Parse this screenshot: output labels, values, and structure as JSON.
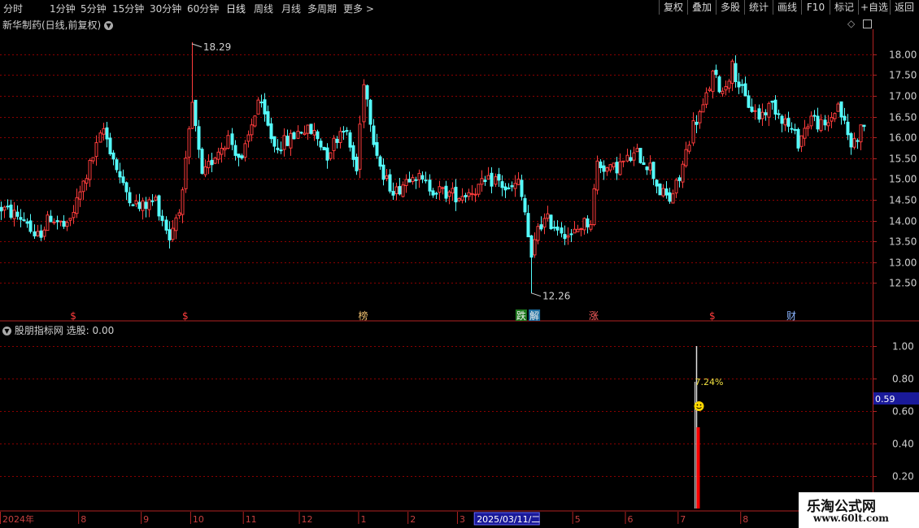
{
  "toolbar": {
    "periods": [
      "分时",
      "1分钟",
      "5分钟",
      "15分钟",
      "30分钟",
      "60分钟",
      "日线",
      "周线",
      "月线",
      "多周期",
      "更多 >"
    ],
    "buttons": [
      "复权",
      "叠加",
      "多股",
      "统计",
      "画线",
      "F10",
      "标记",
      "+自选",
      "返回"
    ]
  },
  "main_panel": {
    "title": "新华制药(日线,前复权)"
  },
  "sub_panel": {
    "title": "股朋指标网",
    "value_label": "选股:",
    "value": "0.00"
  },
  "watermark": {
    "line1": "乐淘公式网",
    "line2": "www.60lt.com"
  },
  "colors": {
    "up": "#ff3c3c",
    "down": "#54fcfc",
    "grid": "#8b0000",
    "axis": "#b22222",
    "highlight": "#1a1a9a"
  },
  "chart_data": [
    {
      "type": "candlestick",
      "title": "新华制药(日线,前复权)",
      "ylim": [
        12.0,
        18.6
      ],
      "y_ticks": [
        "18.00",
        "17.50",
        "17.00",
        "16.50",
        "16.00",
        "15.50",
        "15.00",
        "14.50",
        "14.00",
        "13.50",
        "13.00",
        "12.50"
      ],
      "annotations": [
        {
          "text": "18.29",
          "kind": "high",
          "date_index": 58
        },
        {
          "text": "12.26",
          "kind": "low",
          "date_index": 161
        }
      ],
      "markers": [
        {
          "text": "$",
          "date_index": 22,
          "color": "#ff3c3c"
        },
        {
          "text": "$",
          "date_index": 56,
          "color": "#ff3c3c"
        },
        {
          "text": "榜",
          "date_index": 110,
          "color": "#f0c070"
        },
        {
          "text": "跌",
          "date_index": 158,
          "color": "#f0f0f0",
          "bg": "#1e7a1e"
        },
        {
          "text": "解",
          "date_index": 162,
          "color": "#f0f0f0",
          "bg": "#1e6ea0"
        },
        {
          "text": "涨",
          "date_index": 180,
          "color": "#ff6060"
        },
        {
          "text": "$",
          "date_index": 216,
          "color": "#ff3c3c"
        },
        {
          "text": "财",
          "date_index": 240,
          "color": "#8ab4ff"
        }
      ],
      "x_labels": [
        {
          "text": "2024年",
          "date_index": 0
        },
        {
          "text": "8",
          "date_index": 24
        },
        {
          "text": "9",
          "date_index": 43
        },
        {
          "text": "10",
          "date_index": 58
        },
        {
          "text": "11",
          "date_index": 74
        },
        {
          "text": "12",
          "date_index": 91
        },
        {
          "text": "1",
          "date_index": 109
        },
        {
          "text": "2",
          "date_index": 124
        },
        {
          "text": "3",
          "date_index": 139
        },
        {
          "text": "2025/03/11/二",
          "date_index": 144,
          "highlight": true
        },
        {
          "text": "5",
          "date_index": 174
        },
        {
          "text": "6",
          "date_index": 190
        },
        {
          "text": "7",
          "date_index": 206
        },
        {
          "text": "8",
          "date_index": 225
        },
        {
          "text": "9",
          "date_index": 243
        }
      ],
      "anchors": [
        [
          0,
          14.3
        ],
        [
          8,
          14.0
        ],
        [
          10,
          13.5
        ],
        [
          15,
          14.1
        ],
        [
          20,
          13.8
        ],
        [
          26,
          15.1
        ],
        [
          31,
          16.2
        ],
        [
          34,
          15.5
        ],
        [
          37,
          14.8
        ],
        [
          42,
          14.3
        ],
        [
          47,
          14.5
        ],
        [
          51,
          13.6
        ],
        [
          55,
          14.6
        ],
        [
          58,
          16.8
        ],
        [
          61,
          15.0
        ],
        [
          65,
          15.6
        ],
        [
          69,
          16.0
        ],
        [
          73,
          15.4
        ],
        [
          78,
          16.9
        ],
        [
          83,
          15.8
        ],
        [
          87,
          15.9
        ],
        [
          91,
          16.2
        ],
        [
          95,
          16.1
        ],
        [
          99,
          15.6
        ],
        [
          104,
          16.3
        ],
        [
          108,
          15.2
        ],
        [
          110,
          17.4
        ],
        [
          113,
          16.0
        ],
        [
          116,
          15.0
        ],
        [
          120,
          14.7
        ],
        [
          125,
          15.2
        ],
        [
          128,
          14.9
        ],
        [
          133,
          14.7
        ],
        [
          139,
          14.6
        ],
        [
          145,
          14.8
        ],
        [
          150,
          15.0
        ],
        [
          154,
          14.7
        ],
        [
          157,
          14.9
        ],
        [
          159,
          14.2
        ],
        [
          161,
          13.0
        ],
        [
          163,
          13.9
        ],
        [
          166,
          14.0
        ],
        [
          170,
          13.8
        ],
        [
          173,
          13.6
        ],
        [
          176,
          13.9
        ],
        [
          179,
          14.0
        ],
        [
          181,
          15.4
        ],
        [
          185,
          15.2
        ],
        [
          189,
          15.4
        ],
        [
          193,
          15.6
        ],
        [
          197,
          15.3
        ],
        [
          200,
          14.7
        ],
        [
          203,
          14.5
        ],
        [
          206,
          15.0
        ],
        [
          210,
          16.3
        ],
        [
          213,
          16.7
        ],
        [
          216,
          17.5
        ],
        [
          219,
          17.1
        ],
        [
          222,
          17.7
        ],
        [
          226,
          16.9
        ],
        [
          230,
          16.5
        ],
        [
          234,
          16.8
        ],
        [
          238,
          16.4
        ],
        [
          242,
          15.9
        ],
        [
          246,
          16.5
        ],
        [
          250,
          16.2
        ],
        [
          254,
          16.8
        ],
        [
          258,
          15.8
        ],
        [
          262,
          16.3
        ]
      ]
    },
    {
      "type": "bar",
      "title": "股朋指标网",
      "ylim": [
        0,
        1.05
      ],
      "y_ticks": [
        "1.00",
        "0.80",
        "0.60",
        "0.40",
        "0.20"
      ],
      "current_value_label": "0.59",
      "signal": {
        "date_index": 211,
        "line_value": 1.0,
        "bar_value": 0.5,
        "label": "7.24%"
      }
    }
  ]
}
